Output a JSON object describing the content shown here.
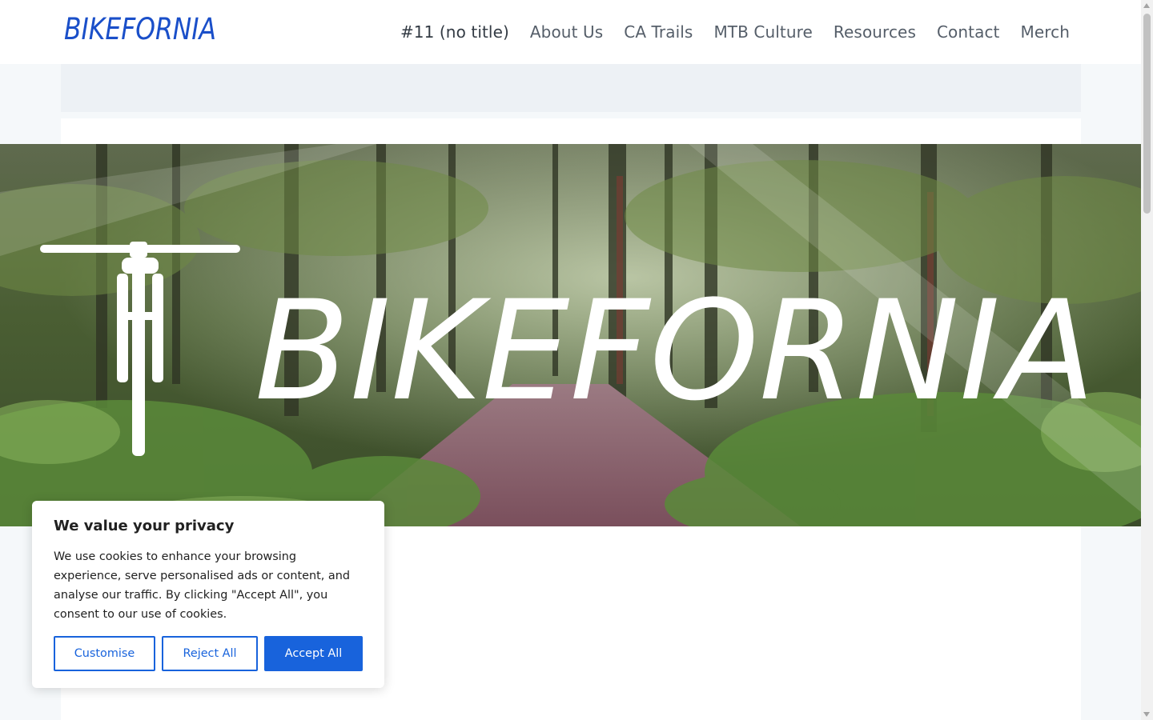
{
  "site": {
    "logo_text": "BIKEFORNIA",
    "brand_color": "#1a4fc9"
  },
  "nav": {
    "items": [
      {
        "label": "#11 (no title)"
      },
      {
        "label": "About Us"
      },
      {
        "label": "CA Trails"
      },
      {
        "label": "MTB Culture"
      },
      {
        "label": "Resources"
      },
      {
        "label": "Contact"
      },
      {
        "label": "Merch"
      }
    ]
  },
  "hero": {
    "title": "BIKEFORNIA",
    "icon": "handlebar-fork-icon",
    "scene": "forest-trail-photo"
  },
  "cookie": {
    "title": "We value your privacy",
    "body": "We use cookies to enhance your browsing experience, serve personalised ads or content, and analyse our traffic. By clicking \"Accept All\", you consent to our use of cookies.",
    "customise_label": "Customise",
    "reject_label": "Reject All",
    "accept_label": "Accept All",
    "accent_color": "#1863dc"
  }
}
